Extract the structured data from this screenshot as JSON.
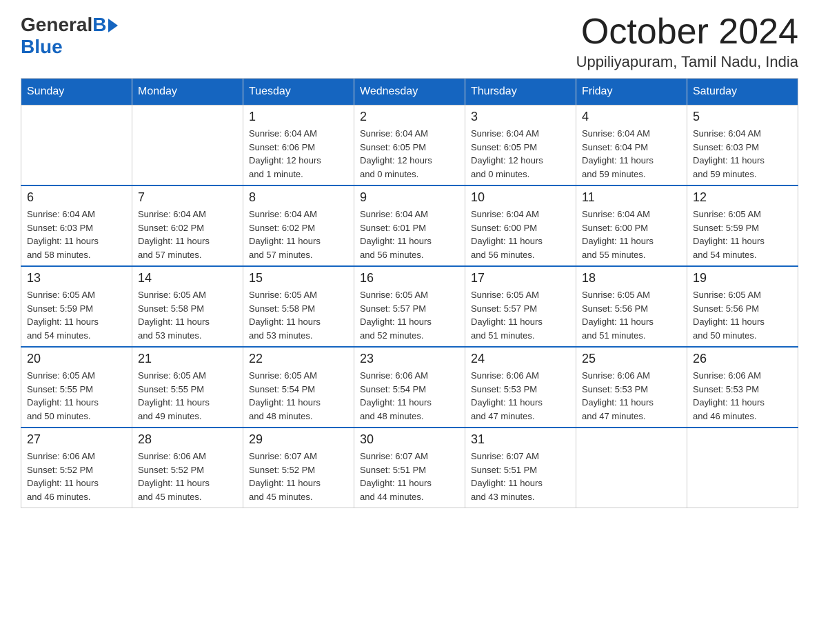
{
  "logo": {
    "general": "General",
    "blue": "Blue"
  },
  "title": "October 2024",
  "location": "Uppiliyapuram, Tamil Nadu, India",
  "days_of_week": [
    "Sunday",
    "Monday",
    "Tuesday",
    "Wednesday",
    "Thursday",
    "Friday",
    "Saturday"
  ],
  "weeks": [
    [
      {
        "day": "",
        "info": ""
      },
      {
        "day": "",
        "info": ""
      },
      {
        "day": "1",
        "info": "Sunrise: 6:04 AM\nSunset: 6:06 PM\nDaylight: 12 hours\nand 1 minute."
      },
      {
        "day": "2",
        "info": "Sunrise: 6:04 AM\nSunset: 6:05 PM\nDaylight: 12 hours\nand 0 minutes."
      },
      {
        "day": "3",
        "info": "Sunrise: 6:04 AM\nSunset: 6:05 PM\nDaylight: 12 hours\nand 0 minutes."
      },
      {
        "day": "4",
        "info": "Sunrise: 6:04 AM\nSunset: 6:04 PM\nDaylight: 11 hours\nand 59 minutes."
      },
      {
        "day": "5",
        "info": "Sunrise: 6:04 AM\nSunset: 6:03 PM\nDaylight: 11 hours\nand 59 minutes."
      }
    ],
    [
      {
        "day": "6",
        "info": "Sunrise: 6:04 AM\nSunset: 6:03 PM\nDaylight: 11 hours\nand 58 minutes."
      },
      {
        "day": "7",
        "info": "Sunrise: 6:04 AM\nSunset: 6:02 PM\nDaylight: 11 hours\nand 57 minutes."
      },
      {
        "day": "8",
        "info": "Sunrise: 6:04 AM\nSunset: 6:02 PM\nDaylight: 11 hours\nand 57 minutes."
      },
      {
        "day": "9",
        "info": "Sunrise: 6:04 AM\nSunset: 6:01 PM\nDaylight: 11 hours\nand 56 minutes."
      },
      {
        "day": "10",
        "info": "Sunrise: 6:04 AM\nSunset: 6:00 PM\nDaylight: 11 hours\nand 56 minutes."
      },
      {
        "day": "11",
        "info": "Sunrise: 6:04 AM\nSunset: 6:00 PM\nDaylight: 11 hours\nand 55 minutes."
      },
      {
        "day": "12",
        "info": "Sunrise: 6:05 AM\nSunset: 5:59 PM\nDaylight: 11 hours\nand 54 minutes."
      }
    ],
    [
      {
        "day": "13",
        "info": "Sunrise: 6:05 AM\nSunset: 5:59 PM\nDaylight: 11 hours\nand 54 minutes."
      },
      {
        "day": "14",
        "info": "Sunrise: 6:05 AM\nSunset: 5:58 PM\nDaylight: 11 hours\nand 53 minutes."
      },
      {
        "day": "15",
        "info": "Sunrise: 6:05 AM\nSunset: 5:58 PM\nDaylight: 11 hours\nand 53 minutes."
      },
      {
        "day": "16",
        "info": "Sunrise: 6:05 AM\nSunset: 5:57 PM\nDaylight: 11 hours\nand 52 minutes."
      },
      {
        "day": "17",
        "info": "Sunrise: 6:05 AM\nSunset: 5:57 PM\nDaylight: 11 hours\nand 51 minutes."
      },
      {
        "day": "18",
        "info": "Sunrise: 6:05 AM\nSunset: 5:56 PM\nDaylight: 11 hours\nand 51 minutes."
      },
      {
        "day": "19",
        "info": "Sunrise: 6:05 AM\nSunset: 5:56 PM\nDaylight: 11 hours\nand 50 minutes."
      }
    ],
    [
      {
        "day": "20",
        "info": "Sunrise: 6:05 AM\nSunset: 5:55 PM\nDaylight: 11 hours\nand 50 minutes."
      },
      {
        "day": "21",
        "info": "Sunrise: 6:05 AM\nSunset: 5:55 PM\nDaylight: 11 hours\nand 49 minutes."
      },
      {
        "day": "22",
        "info": "Sunrise: 6:05 AM\nSunset: 5:54 PM\nDaylight: 11 hours\nand 48 minutes."
      },
      {
        "day": "23",
        "info": "Sunrise: 6:06 AM\nSunset: 5:54 PM\nDaylight: 11 hours\nand 48 minutes."
      },
      {
        "day": "24",
        "info": "Sunrise: 6:06 AM\nSunset: 5:53 PM\nDaylight: 11 hours\nand 47 minutes."
      },
      {
        "day": "25",
        "info": "Sunrise: 6:06 AM\nSunset: 5:53 PM\nDaylight: 11 hours\nand 47 minutes."
      },
      {
        "day": "26",
        "info": "Sunrise: 6:06 AM\nSunset: 5:53 PM\nDaylight: 11 hours\nand 46 minutes."
      }
    ],
    [
      {
        "day": "27",
        "info": "Sunrise: 6:06 AM\nSunset: 5:52 PM\nDaylight: 11 hours\nand 46 minutes."
      },
      {
        "day": "28",
        "info": "Sunrise: 6:06 AM\nSunset: 5:52 PM\nDaylight: 11 hours\nand 45 minutes."
      },
      {
        "day": "29",
        "info": "Sunrise: 6:07 AM\nSunset: 5:52 PM\nDaylight: 11 hours\nand 45 minutes."
      },
      {
        "day": "30",
        "info": "Sunrise: 6:07 AM\nSunset: 5:51 PM\nDaylight: 11 hours\nand 44 minutes."
      },
      {
        "day": "31",
        "info": "Sunrise: 6:07 AM\nSunset: 5:51 PM\nDaylight: 11 hours\nand 43 minutes."
      },
      {
        "day": "",
        "info": ""
      },
      {
        "day": "",
        "info": ""
      }
    ]
  ]
}
